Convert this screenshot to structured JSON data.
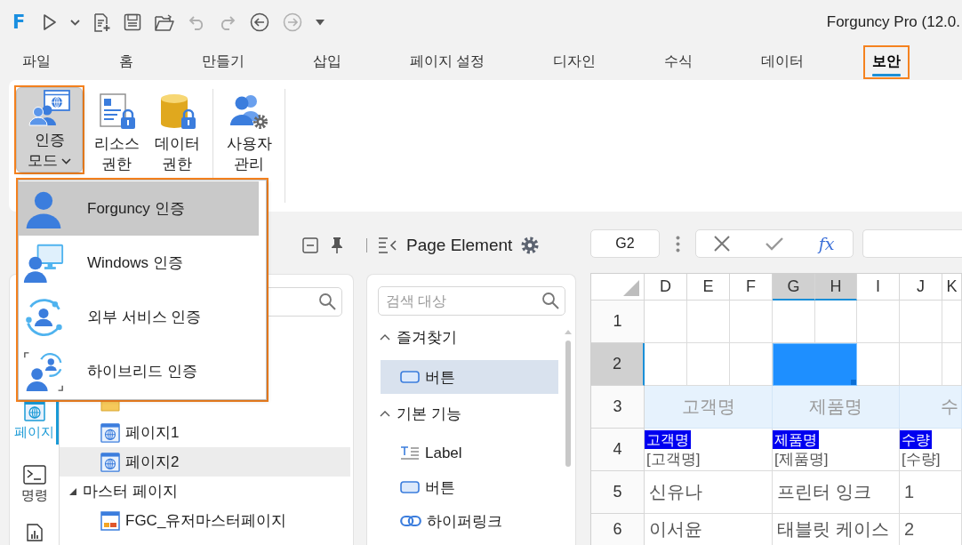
{
  "app_logo": "F",
  "quick_access": [
    {
      "disabled": false
    },
    {
      "disabled": false
    },
    {
      "disabled": false
    },
    {
      "disabled": false
    },
    {
      "disabled": false
    },
    {
      "disabled": true
    },
    {
      "disabled": true
    },
    {
      "disabled": false
    },
    {
      "disabled": true
    },
    {
      "disabled": false
    }
  ],
  "window": {
    "title": "Forguncy Pro (12.0."
  },
  "menu_tabs": [
    {
      "label": "파일",
      "selected": false,
      "highlighted": false
    },
    {
      "label": "홈",
      "selected": false,
      "highlighted": false
    },
    {
      "label": "만들기",
      "selected": false,
      "highlighted": false
    },
    {
      "label": "삽입",
      "selected": false,
      "highlighted": false
    },
    {
      "label": "페이지 설정",
      "selected": false,
      "highlighted": false
    },
    {
      "label": "디자인",
      "selected": false,
      "highlighted": false
    },
    {
      "label": "수식",
      "selected": false,
      "highlighted": false
    },
    {
      "label": "데이터",
      "selected": false,
      "highlighted": false
    },
    {
      "label": "보안",
      "selected": true,
      "highlighted": true
    }
  ],
  "ribbon": {
    "groups": [
      {
        "buttons": [
          {
            "label": "인증 모드",
            "kind": "dropdown",
            "pressed": true,
            "highlighted": true
          },
          {
            "label": "리소스 권한",
            "kind": "button",
            "pressed": false,
            "highlighted": false
          },
          {
            "label": "데이터 권한",
            "kind": "button",
            "pressed": false,
            "highlighted": false
          }
        ]
      },
      {
        "buttons": [
          {
            "label": "사용자 관리",
            "kind": "button",
            "pressed": false,
            "highlighted": false
          }
        ]
      }
    ]
  },
  "auth_menu": {
    "highlighted": true,
    "items": [
      {
        "label": "Forguncy 인증",
        "selected": true
      },
      {
        "label": "Windows 인증",
        "selected": false
      },
      {
        "label": "외부 서비스 인증",
        "selected": false
      },
      {
        "label": "하이브리드 인증",
        "selected": false
      }
    ]
  },
  "nav_items": [
    {
      "label": "페이지",
      "selected": true
    },
    {
      "label": "명령",
      "selected": false
    },
    {
      "selected": false
    }
  ],
  "tree": [
    {
      "expanded": true,
      "children": [
        {
          "kind": "folder"
        },
        {
          "kind": "page",
          "label": "페이지1",
          "selected": false
        },
        {
          "kind": "page",
          "label": "페이지2",
          "selected": true
        }
      ]
    },
    {
      "label": "마스터 페이지",
      "selected": false,
      "expanded": true,
      "children": [
        {
          "kind": "master",
          "label": "FGC_유저마스터페이지",
          "selected": false
        }
      ]
    }
  ],
  "element_panel": {
    "title": "Page Element",
    "search_placeholder": "검색 대상",
    "sections": [
      {
        "label": "즐겨찾기",
        "expanded": true,
        "items": [
          {
            "kind": "button",
            "label": "버튼",
            "selected": true
          }
        ]
      },
      {
        "label": "기본 기능",
        "expanded": true,
        "items": [
          {
            "kind": "label",
            "label": "Label",
            "selected": false
          },
          {
            "kind": "button",
            "label": "버튼",
            "selected": false
          },
          {
            "kind": "link",
            "label": "하이퍼링크",
            "selected": false
          }
        ]
      }
    ]
  },
  "formula_bar": {
    "name_box": "G2",
    "function_label": "fx"
  },
  "sheet": {
    "columns": [
      {
        "label": "D",
        "selected": false
      },
      {
        "label": "E",
        "selected": false
      },
      {
        "label": "F",
        "selected": false
      },
      {
        "label": "G",
        "selected": true
      },
      {
        "label": "H",
        "selected": true
      },
      {
        "label": "I",
        "selected": false
      },
      {
        "label": "J",
        "selected": false
      },
      {
        "label": "K",
        "selected": false
      }
    ],
    "rows": [
      {
        "label": "1",
        "selected": false
      },
      {
        "label": "2",
        "selected": true
      },
      {
        "label": "3",
        "selected": false,
        "cells": [
          {
            "kind": "header",
            "text": "고객명"
          },
          {
            "kind": "header",
            "text": "제품명"
          },
          {
            "kind": "header",
            "text": "수"
          }
        ]
      },
      {
        "label": "4",
        "selected": false,
        "cells": [
          {
            "kind": "binding",
            "tag": "고객명",
            "text": "[고객명]"
          },
          {
            "kind": "binding",
            "tag": "제품명",
            "text": "[제품명]"
          },
          {
            "kind": "binding",
            "tag": "수량",
            "text": "[수량]"
          }
        ]
      },
      {
        "label": "5",
        "selected": false,
        "cells": [
          {
            "kind": "data",
            "text": "신유나"
          },
          {
            "kind": "data",
            "text": "프린터 잉크"
          },
          {
            "kind": "data",
            "text": "1"
          }
        ]
      },
      {
        "label": "6",
        "selected": false,
        "cells": [
          {
            "kind": "data",
            "text": "이서윤"
          },
          {
            "kind": "data",
            "text": "태블릿 케이스"
          },
          {
            "kind": "data",
            "text": "2"
          }
        ]
      }
    ]
  }
}
